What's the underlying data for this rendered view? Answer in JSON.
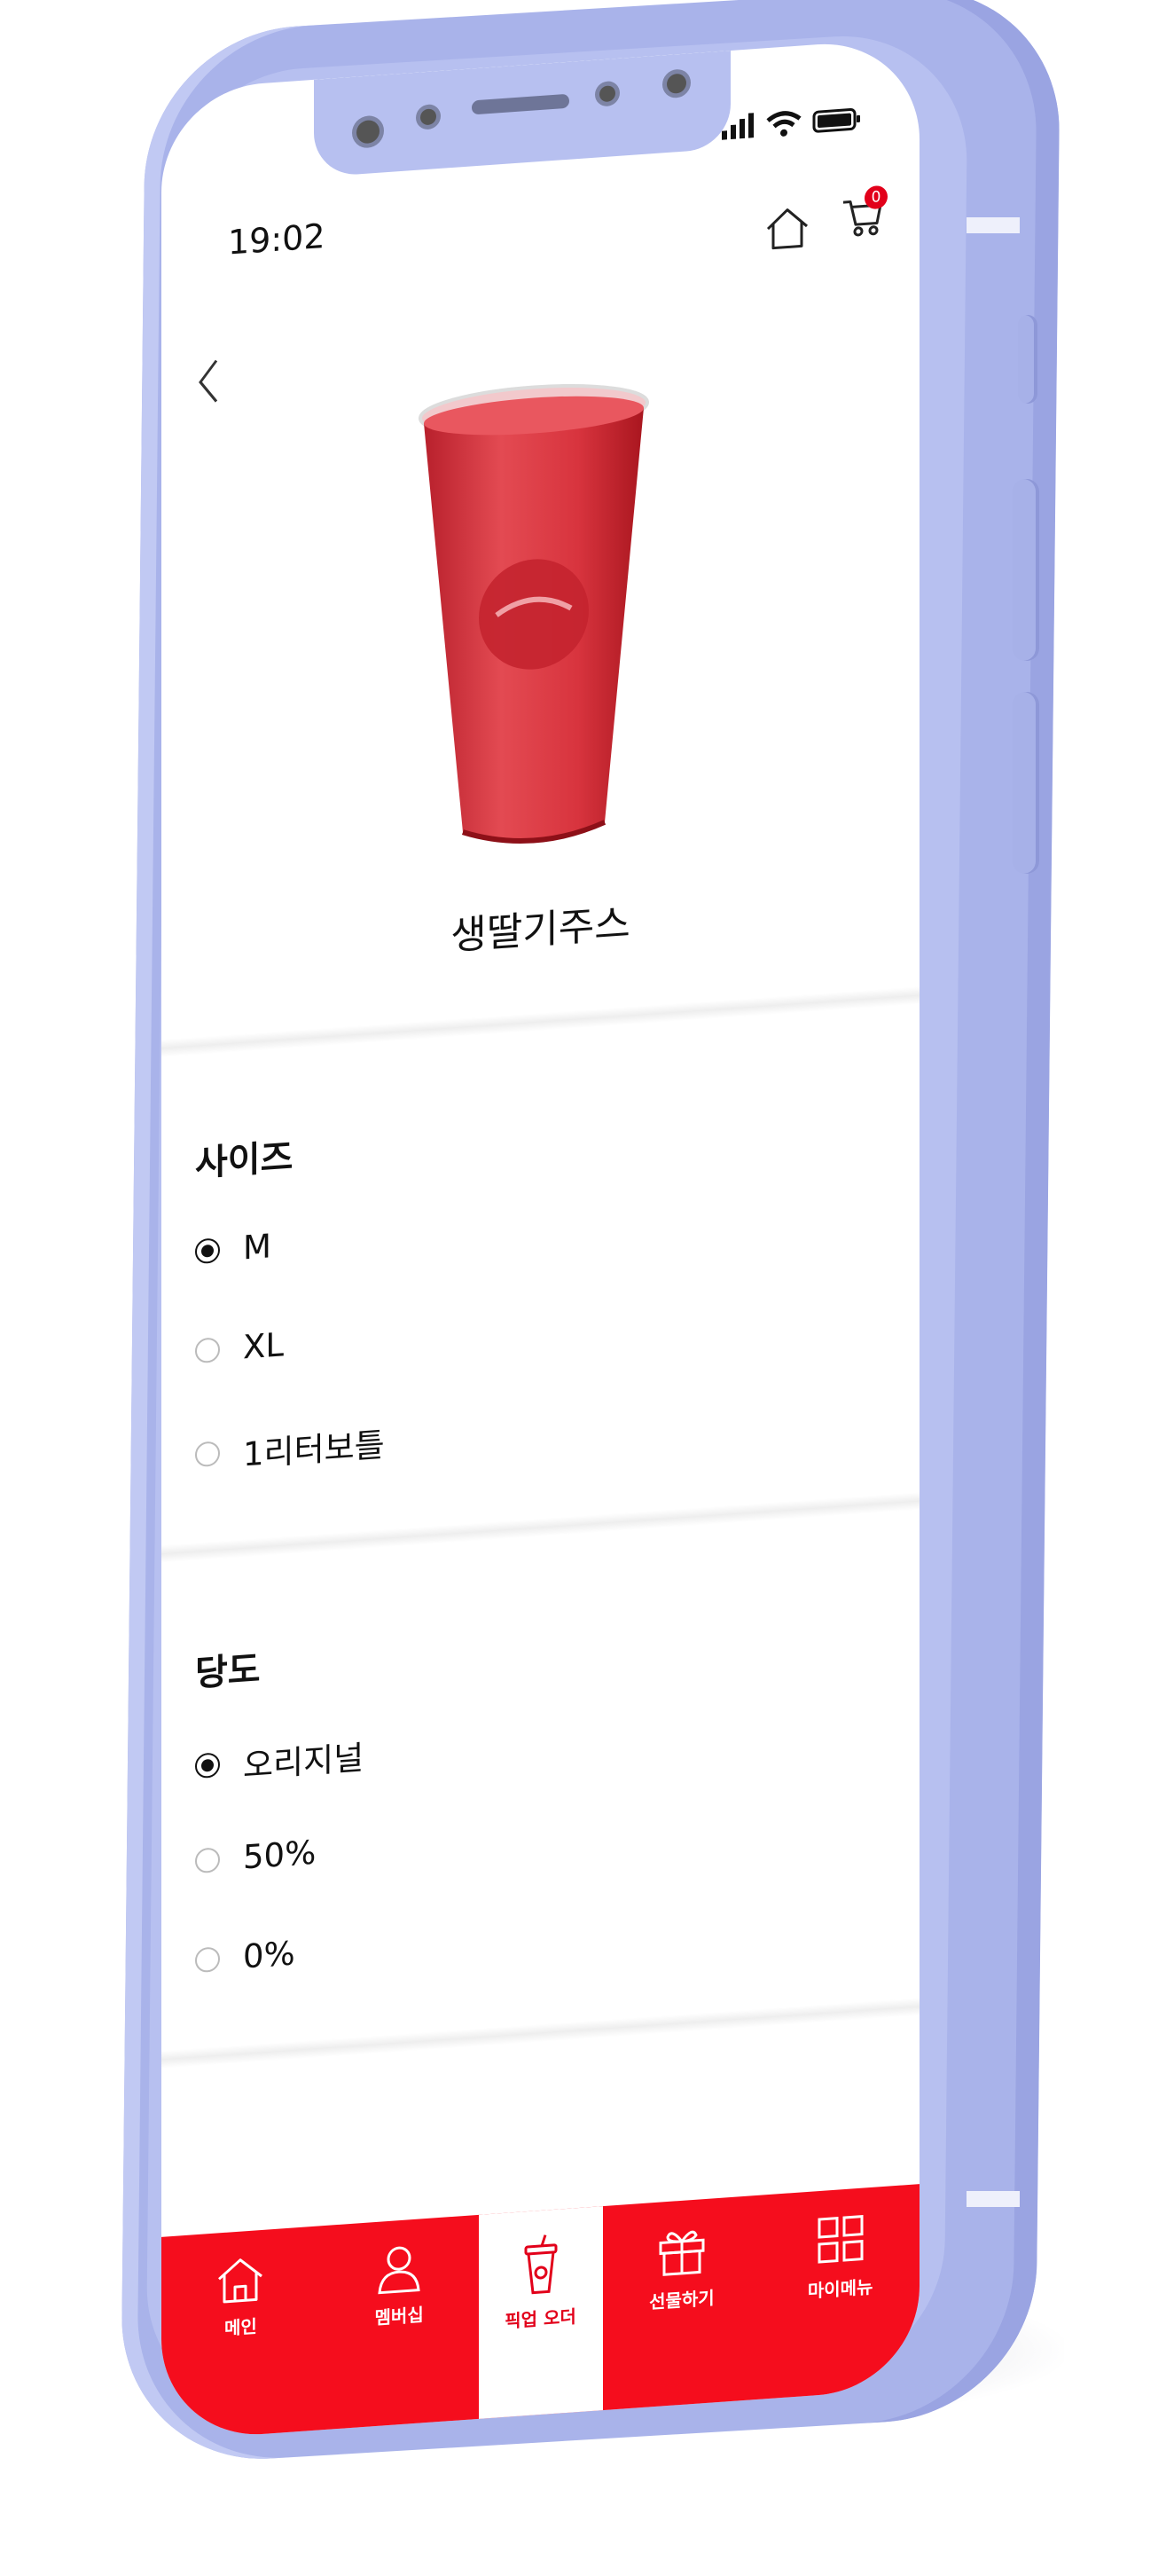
{
  "status_bar": {
    "time": "19:02",
    "icons": [
      "signal-icon",
      "wifi-icon",
      "battery-icon"
    ]
  },
  "header": {
    "icons": [
      "home-icon",
      "cart-icon"
    ],
    "cart_count": "0",
    "back_icon": "chevron-left-icon"
  },
  "product": {
    "name": "생딸기주스",
    "image": "strawberry-juice-cup"
  },
  "size_group": {
    "title": "사이즈",
    "options": [
      {
        "label": "M",
        "selected": true
      },
      {
        "label": "XL",
        "selected": false
      },
      {
        "label": "1리터보틀",
        "selected": false
      }
    ]
  },
  "sweetness_group": {
    "title": "당도",
    "options": [
      {
        "label": "오리지널",
        "selected": true
      },
      {
        "label": "50%",
        "selected": false
      },
      {
        "label": "0%",
        "selected": false
      }
    ]
  },
  "tabbar": {
    "items": [
      {
        "label": "메인",
        "icon": "home-icon"
      },
      {
        "label": "멤버십",
        "icon": "person-icon"
      },
      {
        "label": "픽업 오더",
        "icon": "cup-icon",
        "active": true
      },
      {
        "label": "선물하기",
        "icon": "gift-icon"
      },
      {
        "label": "마이메뉴",
        "icon": "grid-icon"
      }
    ]
  },
  "colors": {
    "brand_red": "#f50d1d",
    "phone_body": "#a9b3ea"
  }
}
